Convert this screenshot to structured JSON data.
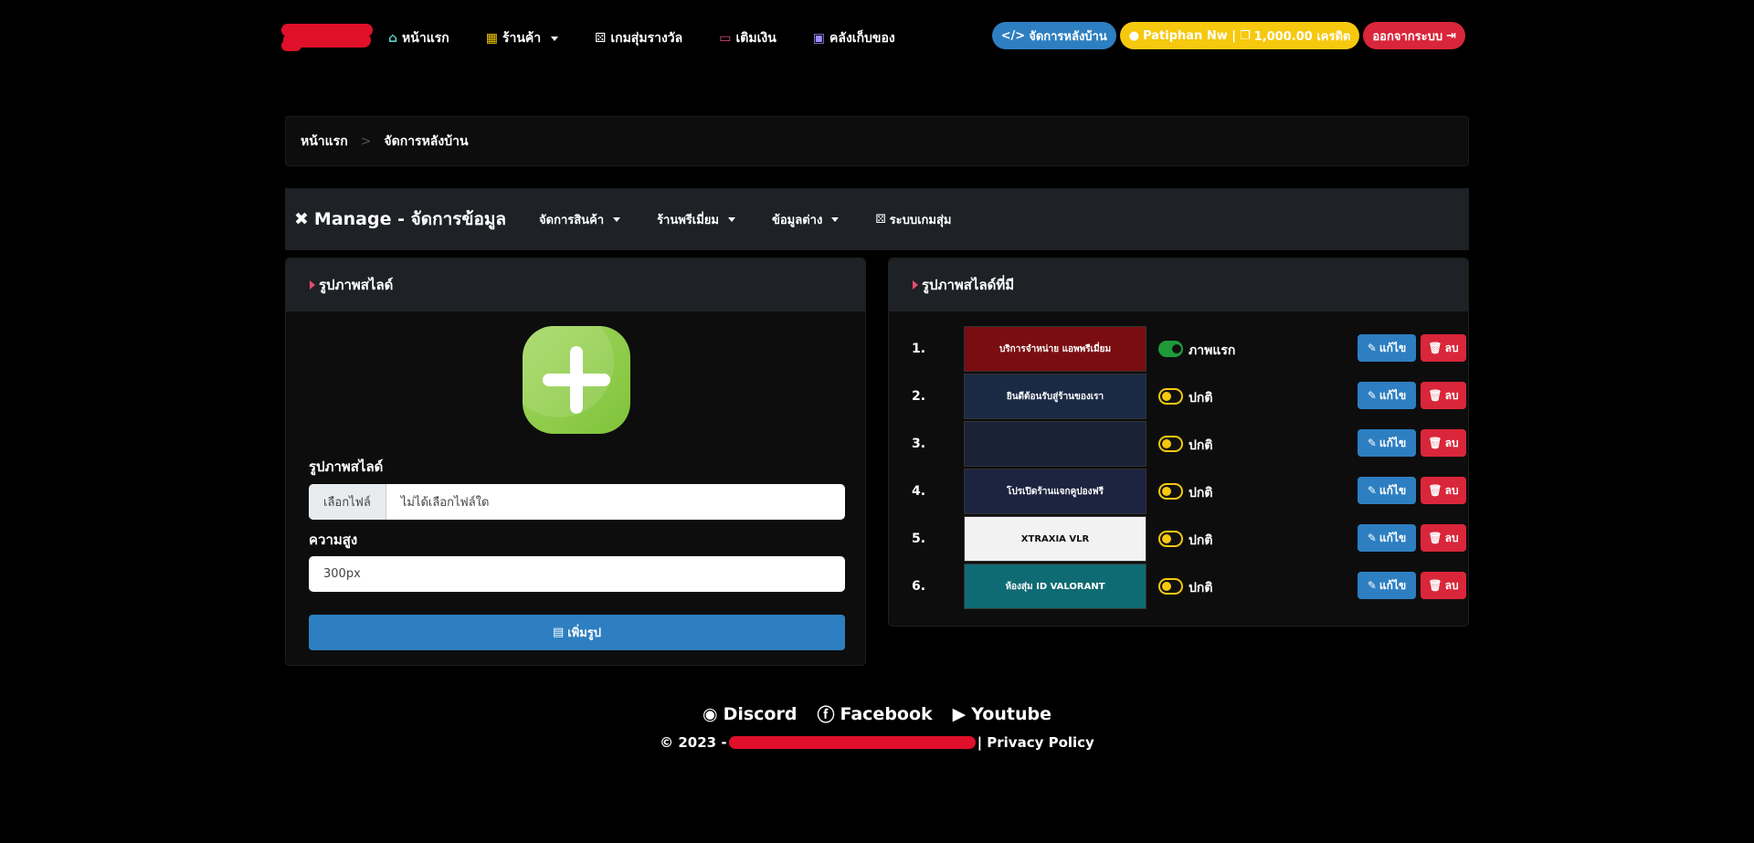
{
  "colors": {
    "accent_blue": "#2d7fc1",
    "accent_yellow": "#f6c90e",
    "accent_red": "#d9263a",
    "success_green": "#1e9a3a"
  },
  "nav": {
    "items": [
      {
        "label": "หน้าแรก",
        "icon": "home-icon"
      },
      {
        "label": "ร้านค้า",
        "icon": "shop-icon",
        "dropdown": true
      },
      {
        "label": "เกมสุ่มรางวัล",
        "icon": "dice-icon"
      },
      {
        "label": "เติมเงิน",
        "icon": "credit-card-icon"
      },
      {
        "label": "คลังเก็บของ",
        "icon": "box-icon"
      }
    ],
    "admin_label": "จัดการหลังบ้าน",
    "user_label": "Patiphan Nw | ",
    "credit_label": "1,000.00 เครดิต",
    "logout_label": "ออกจากระบบ"
  },
  "breadcrumb": {
    "home": "หน้าแรก",
    "separator": ">",
    "current": "จัดการหลังบ้าน"
  },
  "manage": {
    "title": "Manage - จัดการข้อมูล",
    "menu": [
      "จัดการสินค้า",
      "ร้านพรีเมี่ยม",
      "ข้อมูลต่าง",
      "ระบบเกมสุ่ม"
    ]
  },
  "add_slide": {
    "header": "รูปภาพสไลด์",
    "image_label": "รูปภาพสไลด์",
    "file_button": "เลือกไฟล์",
    "file_text": "ไม่ได้เลือกไฟล์ใด",
    "height_label": "ความสูง",
    "height_value": "300px",
    "submit_label": "เพิ่มรูป"
  },
  "slides": {
    "header": "รูปภาพสไลด์ที่มี",
    "edit_label": "แก้ไข",
    "delete_label": "ลบ",
    "rows": [
      {
        "num": "1.",
        "status": "ภาพแรก",
        "on": true,
        "thumb_text": "บริการจำหน่าย แอพพรีเมี่ยม",
        "thumb_bg": "#7a0d10",
        "thumb_fg": "#ffffff"
      },
      {
        "num": "2.",
        "status": "ปกติ",
        "on": false,
        "thumb_text": "ยินดีต้อนรับสู่ร้านของเรา",
        "thumb_bg": "#1b2a44",
        "thumb_fg": "#ffffff"
      },
      {
        "num": "3.",
        "status": "ปกติ",
        "on": false,
        "thumb_text": "",
        "thumb_bg": "#1a2238",
        "thumb_fg": "#ffffff"
      },
      {
        "num": "4.",
        "status": "ปกติ",
        "on": false,
        "thumb_text": "โปรเปิดร้านแจกคูปองฟรี",
        "thumb_bg": "#1c2440",
        "thumb_fg": "#ffffff"
      },
      {
        "num": "5.",
        "status": "ปกติ",
        "on": false,
        "thumb_text": "XTRAXIA VLR",
        "thumb_bg": "#f2f2f2",
        "thumb_fg": "#111111"
      },
      {
        "num": "6.",
        "status": "ปกติ",
        "on": false,
        "thumb_text": "ห้องสุ่ม ID VALORANT",
        "thumb_bg": "#0f6b73",
        "thumb_fg": "#ffffff"
      }
    ]
  },
  "footer": {
    "links": [
      {
        "label": "Discord",
        "icon": "discord-icon"
      },
      {
        "label": "Facebook",
        "icon": "facebook-icon"
      },
      {
        "label": "Youtube",
        "icon": "youtube-icon"
      }
    ],
    "copyright_prefix": "© 2023 -",
    "privacy": "| Privacy Policy"
  }
}
